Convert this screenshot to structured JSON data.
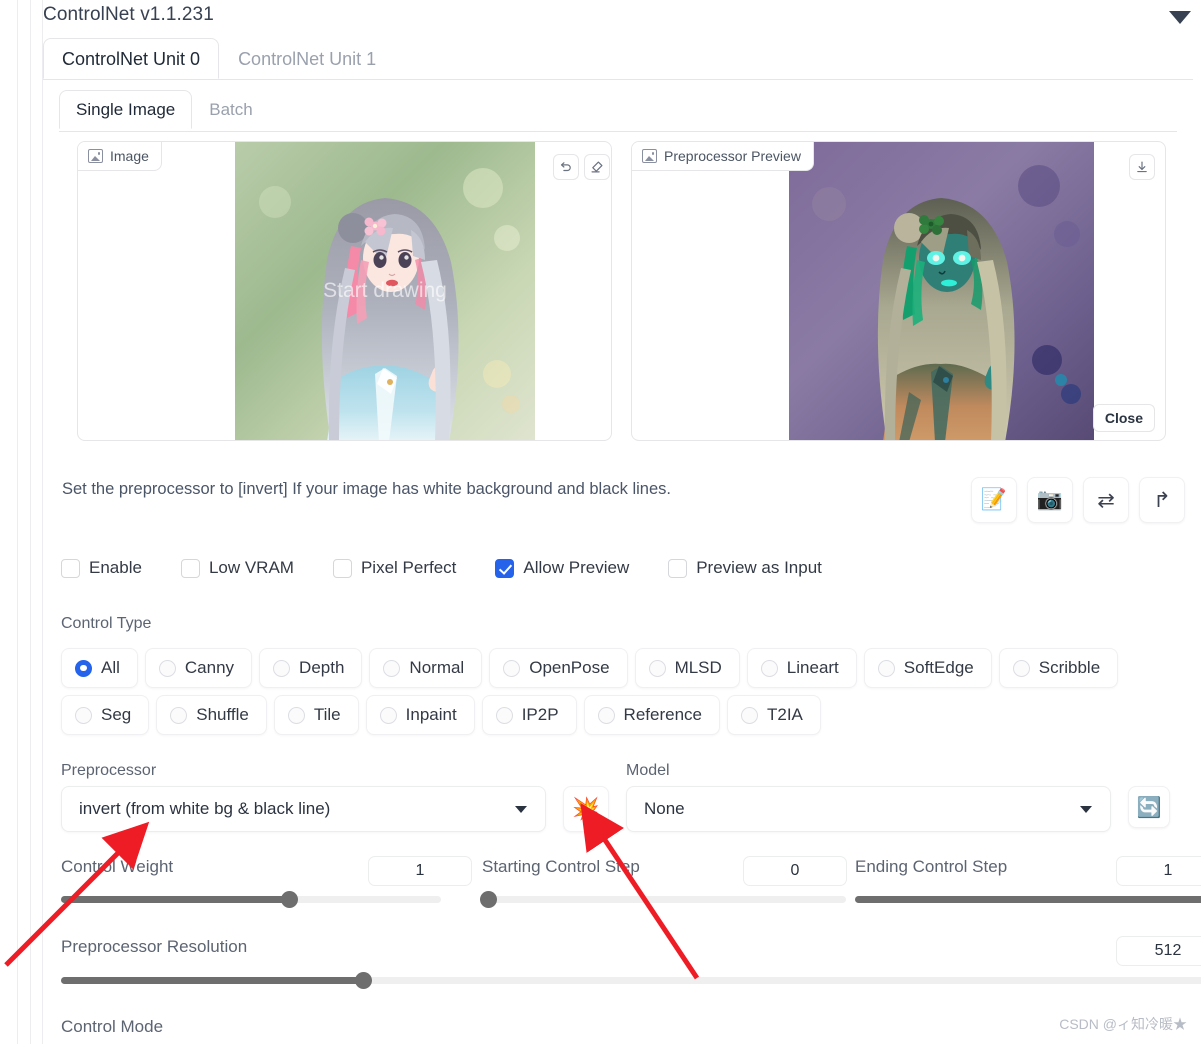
{
  "header": {
    "title": "ControlNet v1.1.231",
    "collapse_icon": "chevron-down-icon"
  },
  "unit_tabs": [
    {
      "label": "ControlNet Unit 0",
      "active": true
    },
    {
      "label": "ControlNet Unit 1",
      "active": false
    }
  ],
  "source_tabs": [
    {
      "label": "Single Image",
      "active": true
    },
    {
      "label": "Batch",
      "active": false
    }
  ],
  "input_panel": {
    "tag": "Image",
    "tag_icon": "image-icon",
    "canvas_watermark": "Start drawing",
    "tools": [
      {
        "name": "undo-icon",
        "glyph": "↺"
      },
      {
        "name": "eraser-icon",
        "glyph": "◇"
      },
      {
        "name": "close-icon",
        "glyph": "✕"
      },
      {
        "name": "pen-edit-icon",
        "glyph": "✎"
      }
    ]
  },
  "preview_panel": {
    "tag": "Preprocessor Preview",
    "tag_icon": "image-icon",
    "download_icon": "download-icon",
    "close_label": "Close"
  },
  "hint": {
    "text": "Set the preprocessor to [invert] If your image has white background and black lines."
  },
  "toolbar_icons": [
    {
      "name": "edit-prompt-icon",
      "glyph": "📝"
    },
    {
      "name": "camera-icon",
      "glyph": "📷"
    },
    {
      "name": "swap-icon",
      "glyph": "⇄"
    },
    {
      "name": "arrow-turn-up-icon",
      "glyph": "↱"
    }
  ],
  "checkboxes": [
    {
      "label": "Enable",
      "checked": false
    },
    {
      "label": "Low VRAM",
      "checked": false
    },
    {
      "label": "Pixel Perfect",
      "checked": false
    },
    {
      "label": "Allow Preview",
      "checked": true
    },
    {
      "label": "Preview as Input",
      "checked": false
    }
  ],
  "control_type": {
    "label": "Control Type",
    "row1": [
      {
        "label": "All",
        "selected": true
      },
      {
        "label": "Canny",
        "selected": false
      },
      {
        "label": "Depth",
        "selected": false
      },
      {
        "label": "Normal",
        "selected": false
      },
      {
        "label": "OpenPose",
        "selected": false
      },
      {
        "label": "MLSD",
        "selected": false
      },
      {
        "label": "Lineart",
        "selected": false
      },
      {
        "label": "SoftEdge",
        "selected": false
      },
      {
        "label": "Scribble",
        "selected": false
      }
    ],
    "row2": [
      {
        "label": "Seg",
        "selected": false
      },
      {
        "label": "Shuffle",
        "selected": false
      },
      {
        "label": "Tile",
        "selected": false
      },
      {
        "label": "Inpaint",
        "selected": false
      },
      {
        "label": "IP2P",
        "selected": false
      },
      {
        "label": "Reference",
        "selected": false
      },
      {
        "label": "T2IA",
        "selected": false
      }
    ]
  },
  "preprocessor": {
    "label": "Preprocessor",
    "value": "invert (from white bg & black line)",
    "run_icon": "explosion-icon",
    "run_glyph": "💥"
  },
  "model": {
    "label": "Model",
    "value": "None",
    "refresh_icon": "refresh-icon",
    "refresh_glyph": "🔄"
  },
  "sliders": {
    "control_weight": {
      "label": "Control Weight",
      "value": "1",
      "percent": 60
    },
    "starting_control_step": {
      "label": "Starting Control Step",
      "value": "0",
      "percent": 0
    },
    "ending_control_step": {
      "label": "Ending Control Step",
      "value": "1",
      "percent": 100
    },
    "preprocessor_resolution": {
      "label": "Preprocessor Resolution",
      "value": "512",
      "percent": 26
    }
  },
  "control_mode": {
    "label": "Control Mode"
  },
  "watermark": {
    "text": "CSDN @ィ知冷暖★"
  },
  "colors": {
    "accent_blue": "#2563eb",
    "slider_gray": "#6e6e6e",
    "annotation_red": "#ee1c25",
    "text_dark": "#333a45",
    "text_muted": "#9aa1ad"
  }
}
